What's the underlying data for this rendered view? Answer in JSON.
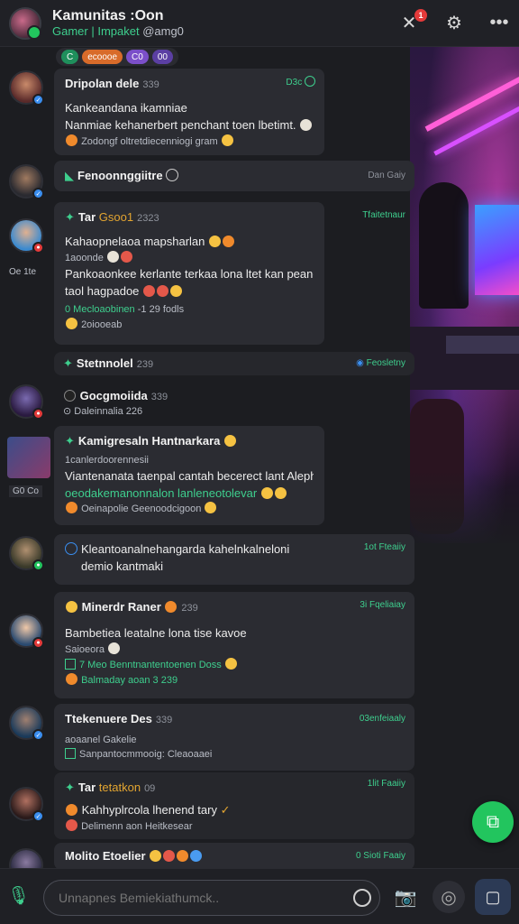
{
  "header": {
    "title": "Kamunitas :Oon",
    "subtitle_highlight": "Gamer | Impaket",
    "subtitle_rest": " @amg0",
    "notif_count": "1"
  },
  "pills": [
    "C",
    "ecoooe",
    "C0",
    "00"
  ],
  "messages": [
    {
      "name": "Dripolan dele",
      "meta": "339",
      "time": "D3c",
      "lines": [
        "Kankeandana ikamniae",
        "Nanmiae kehanerbert penchant toen lbetimt.",
        "Zodongf oltretdiecenniogi gram"
      ]
    },
    {
      "name": "Fenoonnggiitre",
      "meta": "",
      "time": "Dan Gaiy",
      "lines": []
    },
    {
      "name": "Tar",
      "meta_gold": "Gsoo1",
      "meta": "2323",
      "time": "Tfaitetnaur",
      "lines": [
        "Kahaopnelaoa mapsharlan",
        "1aoonde",
        "Pankoaonkee kerlante terkaa lona ltet kan peandya",
        "taol hagpadoe",
        "0  Mecloaobinen",
        "-1  29 fodls",
        "2oiooeab"
      ]
    },
    {
      "name": "Stetnnolel",
      "meta": "239",
      "time": "Feosletny",
      "lines": []
    },
    {
      "name": "Gocgmoiida",
      "meta": "339",
      "time": "",
      "lines": [
        "Daleinnalia 226"
      ]
    },
    {
      "name": "Kamigresaln Hantnarkara",
      "meta": "",
      "time": "",
      "lines": [
        "1canlerdoorennesii",
        "Viantenanata taenpal cantah becerect lant Alepha",
        "oeodakemanonnalon lanleneotolevar",
        "Oeinapolie Geenoodcigoon"
      ]
    },
    {
      "name": "Kleantoanalnehangarda kahelnkalneloni",
      "meta": "",
      "time": "1ot Fteaiiy",
      "lines": [
        "demio kantmaki"
      ]
    },
    {
      "name": "Minerdr Raner",
      "meta": "239",
      "time": "3i Fqeliaiay",
      "lines": [
        "Bambetiea leatalne lona tise kavoe",
        "Saioeora",
        "7 Meo Benntnantentoenen Doss",
        "Balmaday aoan 3 239"
      ]
    },
    {
      "name": "Ttekenuere Des",
      "meta": "339",
      "time": "03enfeiaaly",
      "lines": [
        "aoaanel Gakelie",
        "Sanpantocmmooig: Cleaoaaei"
      ]
    },
    {
      "name": "Tar",
      "meta_gold": "tetatkon",
      "meta": "09",
      "time": "1lit Faaiiy",
      "lines": [
        "Kahhyplrcola lhenend tary",
        "Delimenn aon Heitkesear"
      ]
    },
    {
      "name": "Molito Etoelier",
      "meta": "",
      "time": "0 Sioti Faaiy",
      "lines": []
    }
  ],
  "side_labels": [
    "Oe  1te",
    "G0  Co"
  ],
  "composer": {
    "placeholder": "Unnapnes Bemiekiathumck.."
  },
  "colors": {
    "accent": "#3ecf8e",
    "bubble": "#2b2c32",
    "background": "#1c1d21",
    "badge": "#e43a3a"
  }
}
